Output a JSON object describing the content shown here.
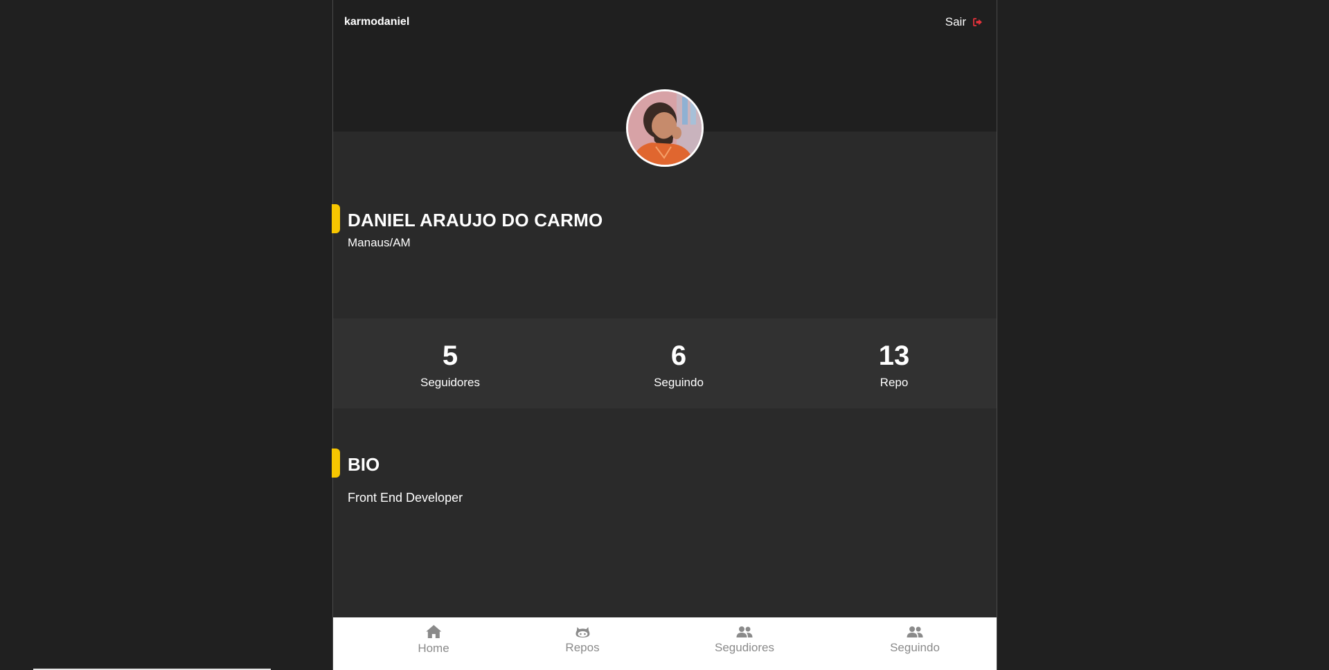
{
  "header": {
    "username": "karmodaniel",
    "logout_label": "Sair",
    "logout_icon": "sign-out-icon",
    "logout_icon_color": "#e5323b"
  },
  "profile": {
    "name": "DANIEL ARAUJO DO CARMO",
    "location": "Manaus/AM",
    "accent_color": "#f7c600"
  },
  "stats": [
    {
      "value": "5",
      "label": "Seguidores"
    },
    {
      "value": "6",
      "label": "Seguindo"
    },
    {
      "value": "13",
      "label": "Repo"
    }
  ],
  "bio": {
    "title": "BIO",
    "text": "Front End Developer"
  },
  "bottom_nav": [
    {
      "label": "Home",
      "icon": "home-icon"
    },
    {
      "label": "Repos",
      "icon": "github-icon"
    },
    {
      "label": "Segudiores",
      "icon": "users-icon"
    },
    {
      "label": "Seguindo",
      "icon": "users-icon"
    }
  ]
}
